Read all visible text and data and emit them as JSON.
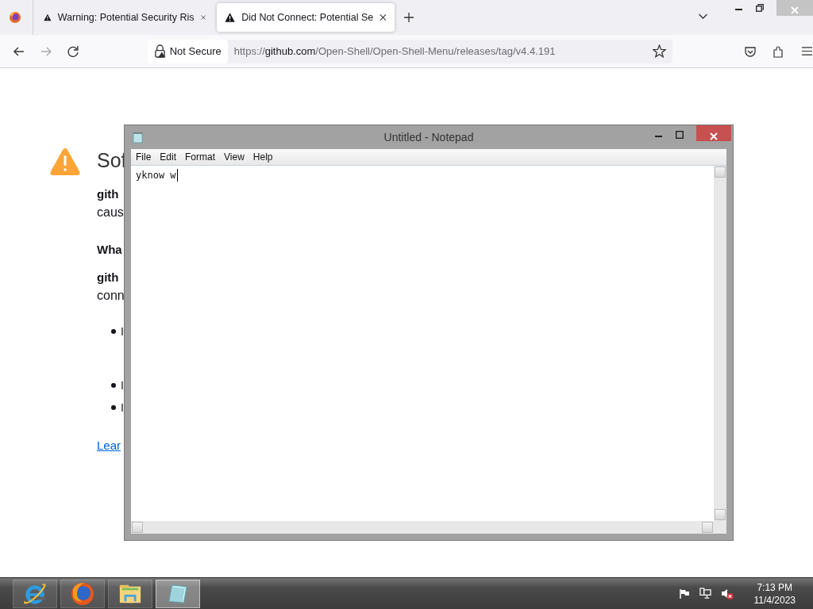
{
  "browser": {
    "tabs": [
      {
        "title": "Warning: Potential Security Ris",
        "selected": false
      },
      {
        "title": "Did Not Connect: Potential Se",
        "selected": true
      }
    ],
    "address_bar": {
      "security_label": "Not Secure",
      "url_scheme": "https://",
      "url_host": "github.com",
      "url_path": "/Open-Shell/Open-Shell-Menu/releases/tag/v4.4.191"
    }
  },
  "error_page": {
    "title": "Sof",
    "blocks": [
      {
        "kind": "paragraph",
        "lines": [
          {
            "text": "gith",
            "bold": true
          },
          {
            "text": "caus",
            "bold": false
          }
        ]
      },
      {
        "kind": "heading",
        "text": "Wha"
      },
      {
        "kind": "paragraph",
        "lines": [
          {
            "text": "gith",
            "bold": true
          },
          {
            "text": "conn",
            "bold": false
          }
        ]
      },
      {
        "kind": "list",
        "items": [
          [
            "I"
          ],
          [
            "I"
          ],
          [
            "I"
          ]
        ]
      },
      {
        "kind": "link",
        "text": "Lear"
      }
    ]
  },
  "notepad": {
    "title": "Untitled - Notepad",
    "menu": [
      "File",
      "Edit",
      "Format",
      "View",
      "Help"
    ],
    "text": "yknow w"
  },
  "taskbar": {
    "apps": [
      {
        "kind": "ie",
        "selected": false
      },
      {
        "kind": "firefox",
        "selected": false
      },
      {
        "kind": "explorer",
        "selected": false
      },
      {
        "kind": "notepad",
        "selected": true
      }
    ],
    "clock": {
      "time": "7:13 PM",
      "date": "11/4/2023"
    }
  }
}
